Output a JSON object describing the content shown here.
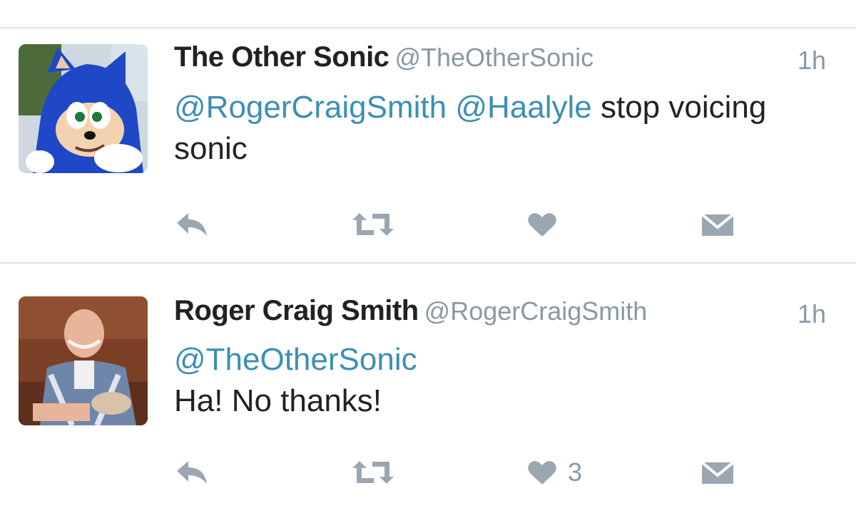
{
  "colors": {
    "mention": "#3c8fb5",
    "handle": "#8899a6",
    "icon": "#9aa7b3",
    "divider": "#e1e4e8"
  },
  "tweets": [
    {
      "display_name": "The Other Sonic",
      "handle": "@TheOtherSonic",
      "timestamp": "1h",
      "avatar_icon": "sonic-avatar",
      "mention_1": "@RogerCraigSmith",
      "mention_2": "@Haalyle",
      "text_line_1_rest": " stop voicing",
      "text_line_2": "sonic",
      "actions": {
        "reply_icon": "reply-icon",
        "retweet_icon": "retweet-icon",
        "like_icon": "heart-icon",
        "like_count": "",
        "dm_icon": "envelope-icon"
      }
    },
    {
      "display_name": "Roger Craig Smith",
      "handle": "@RogerCraigSmith",
      "timestamp": "1h",
      "avatar_icon": "person-avatar",
      "mention_1": "@TheOtherSonic",
      "text_line_2": "Ha! No thanks!",
      "actions": {
        "reply_icon": "reply-icon",
        "retweet_icon": "retweet-icon",
        "like_icon": "heart-icon",
        "like_count": "3",
        "dm_icon": "envelope-icon"
      }
    }
  ]
}
